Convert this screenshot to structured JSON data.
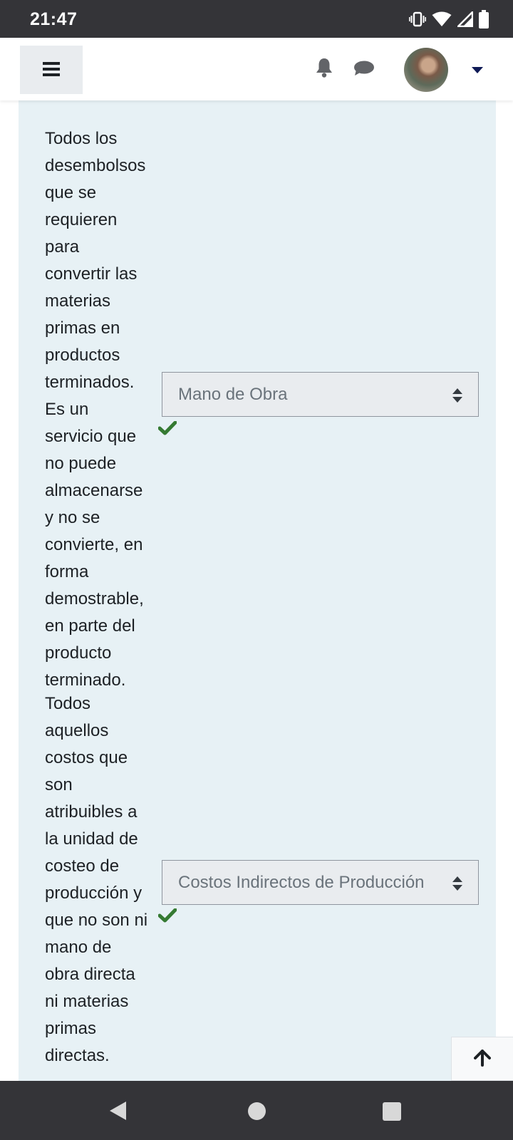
{
  "status_bar": {
    "time": "21:47",
    "icons": [
      "vibrate-icon",
      "wifi-icon",
      "signal-icon",
      "battery-icon"
    ]
  },
  "navbar": {
    "menu_icon": "hamburger-icon",
    "notifications_icon": "bell-icon",
    "messages_icon": "chat-icon",
    "user_menu_icon": "caret-down-icon"
  },
  "questions": [
    {
      "text": "Todos los\ndesembolsos\nque se\nrequieren\npara\nconvertir las\nmaterias\nprimas en\nproductos\nterminados.\nEs un\nservicio que\nno puede\nalmacenarse\ny no se\nconvierte, en\nforma\ndemostrable,\nen parte del\nproducto\nterminado.",
      "selected": "Mano de Obra",
      "status": "correct"
    },
    {
      "text": " Todos\naquellos\ncostos que\nson\natribuibles a\nla unidad de\ncosteo de\nproducción y\nque no son ni\nmano de\nobra directa\nni materias\nprimas\ndirectas.",
      "selected": "Costos Indirectos de Producción",
      "status": "correct"
    }
  ],
  "colors": {
    "panel_bg": "#e7f1f5",
    "correct": "#357a32",
    "status_bar": "#343438",
    "nav_caret": "#0f1a56"
  }
}
